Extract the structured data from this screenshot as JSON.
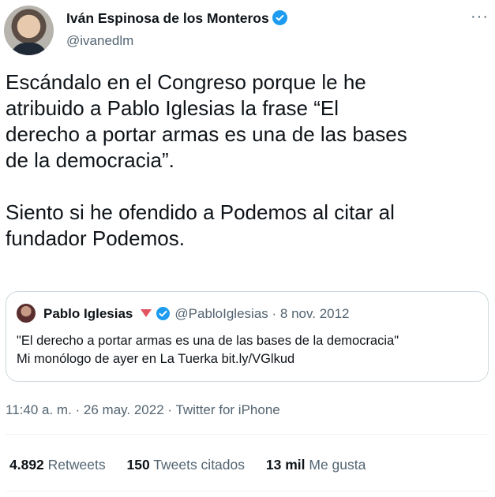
{
  "author": {
    "name": "Iván Espinosa de los Monteros",
    "handle": "@ivanedlm",
    "verified": true
  },
  "more_icon": "ellipsis-icon",
  "text": "Escándalo en el Congreso porque le he\natribuido a Pablo Iglesias la frase “El\nderecho a portar armas es una de las bases\nde la democracia”.\n\nSiento si he ofendido a Podemos al citar al\nfundador Podemos.",
  "quote": {
    "name": "Pablo Iglesias",
    "handle": "@PabloIglesias",
    "separator": "·",
    "date": "8 nov. 2012",
    "text": "\"El derecho a portar armas es una de las bases de la democracia\"\nMi monólogo de ayer en La Tuerka bit.ly/VGlkud"
  },
  "timestamp": "11:40 a. m. · 26 may. 2022 · Twitter for iPhone",
  "stats": {
    "retweets": {
      "count": "4.892",
      "label": "Retweets"
    },
    "quotes": {
      "count": "150",
      "label": "Tweets citados"
    },
    "likes": {
      "count": "13 mil",
      "label": "Me gusta"
    }
  },
  "colors": {
    "verified": "#1d9bf0",
    "secondary_text": "#536471",
    "border": "#cfd9de",
    "party_triangle": "#e0555f"
  }
}
